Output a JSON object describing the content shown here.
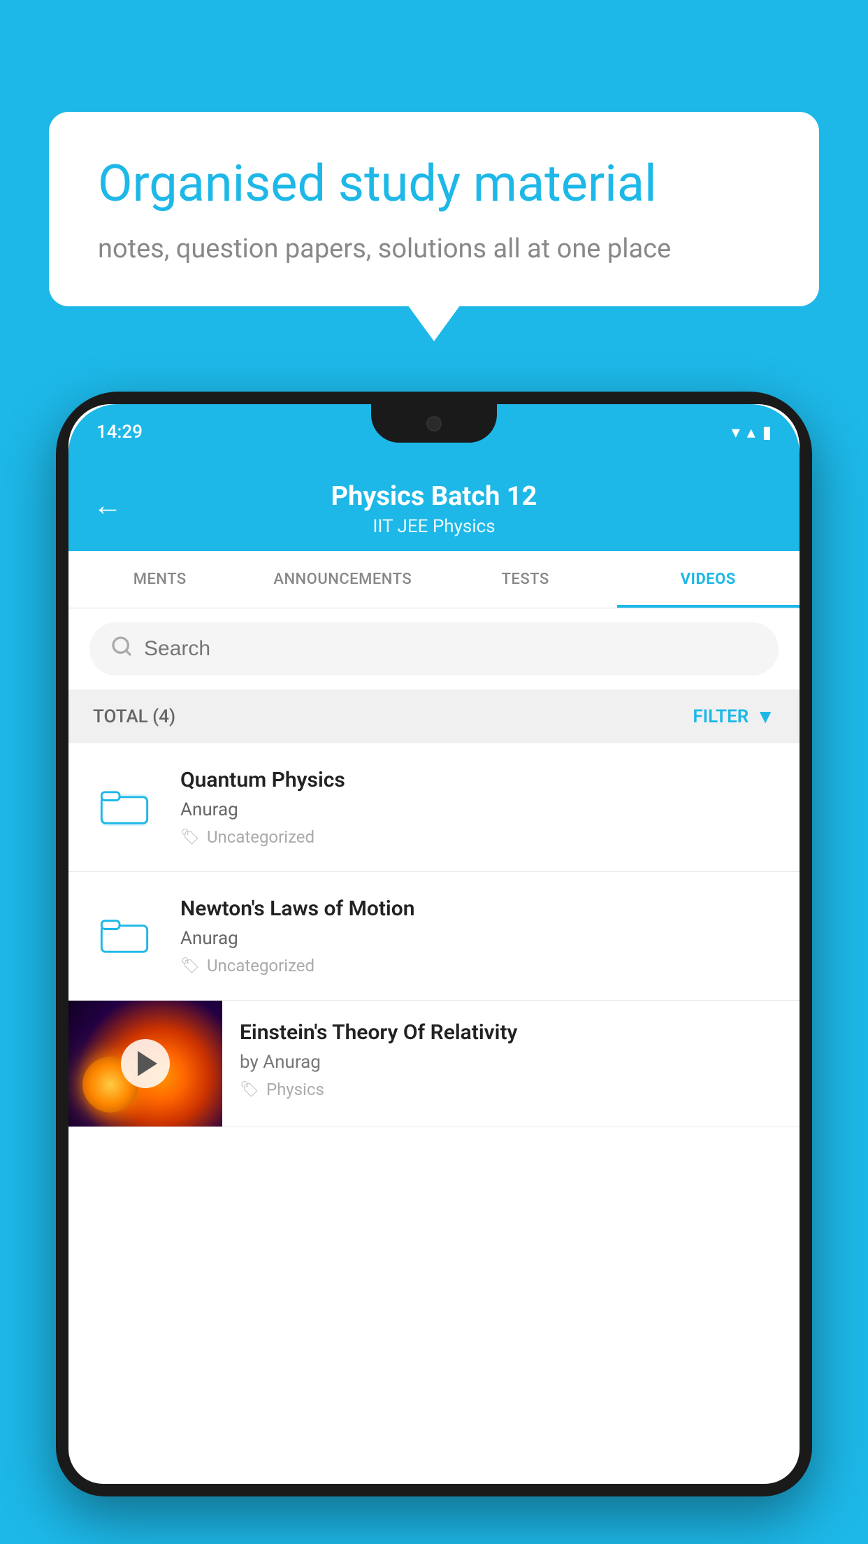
{
  "background_color": "#1db8e8",
  "bubble": {
    "title": "Organised study material",
    "subtitle": "notes, question papers, solutions all at one place"
  },
  "phone": {
    "status_bar": {
      "time": "14:29",
      "wifi": "▾",
      "signal": "▴",
      "battery": "▮"
    },
    "header": {
      "back_label": "←",
      "title": "Physics Batch 12",
      "subtitle": "IIT JEE   Physics"
    },
    "tabs": [
      {
        "label": "MENTS",
        "active": false
      },
      {
        "label": "ANNOUNCEMENTS",
        "active": false
      },
      {
        "label": "TESTS",
        "active": false
      },
      {
        "label": "VIDEOS",
        "active": true
      }
    ],
    "search": {
      "placeholder": "Search"
    },
    "filter_bar": {
      "total_label": "TOTAL (4)",
      "filter_label": "FILTER"
    },
    "videos": [
      {
        "id": 1,
        "title": "Quantum Physics",
        "author": "Anurag",
        "tag": "Uncategorized",
        "has_thumbnail": false
      },
      {
        "id": 2,
        "title": "Newton's Laws of Motion",
        "author": "Anurag",
        "tag": "Uncategorized",
        "has_thumbnail": false
      },
      {
        "id": 3,
        "title": "Einstein's Theory Of Relativity",
        "author": "by Anurag",
        "tag": "Physics",
        "has_thumbnail": true
      }
    ]
  }
}
